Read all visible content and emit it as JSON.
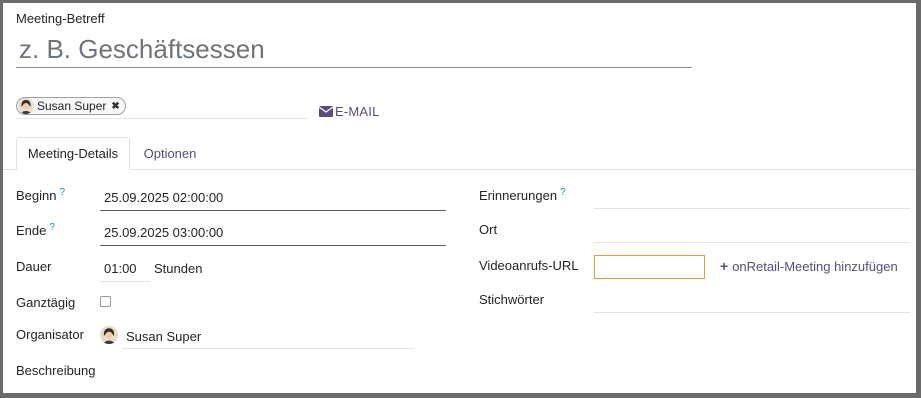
{
  "title": {
    "label": "Meeting-Betreff",
    "placeholder": "z. B. Geschäftsessen"
  },
  "attendees": [
    {
      "name": "Susan Super",
      "remove_icon": "close-icon"
    }
  ],
  "email_button": {
    "label": "E-MAIL",
    "icon": "envelope-icon"
  },
  "tabs": [
    {
      "label": "Meeting-Details",
      "active": true
    },
    {
      "label": "Optionen",
      "active": false
    }
  ],
  "left_fields": {
    "start": {
      "label": "Beginn",
      "help": "?",
      "value": "25.09.2025 02:00:00"
    },
    "end": {
      "label": "Ende",
      "help": "?",
      "value": "25.09.2025 03:00:00"
    },
    "duration": {
      "label": "Dauer",
      "value": "01:00",
      "unit": "Stunden"
    },
    "allday": {
      "label": "Ganztägig",
      "checked": false
    },
    "organizer": {
      "label": "Organisator",
      "value": "Susan Super"
    },
    "description": {
      "label": "Beschreibung"
    }
  },
  "right_fields": {
    "reminders": {
      "label": "Erinnerungen",
      "help": "?"
    },
    "location": {
      "label": "Ort"
    },
    "video_url": {
      "label": "Videoanrufs-URL",
      "value": ""
    },
    "add_meeting": {
      "label": "onRetail-Meeting hinzufügen",
      "icon": "plus-icon"
    },
    "tags": {
      "label": "Stichwörter"
    }
  },
  "colors": {
    "link": "#5f4b7c",
    "help": "#1a8fc4",
    "focus_border": "#e59a3f"
  }
}
